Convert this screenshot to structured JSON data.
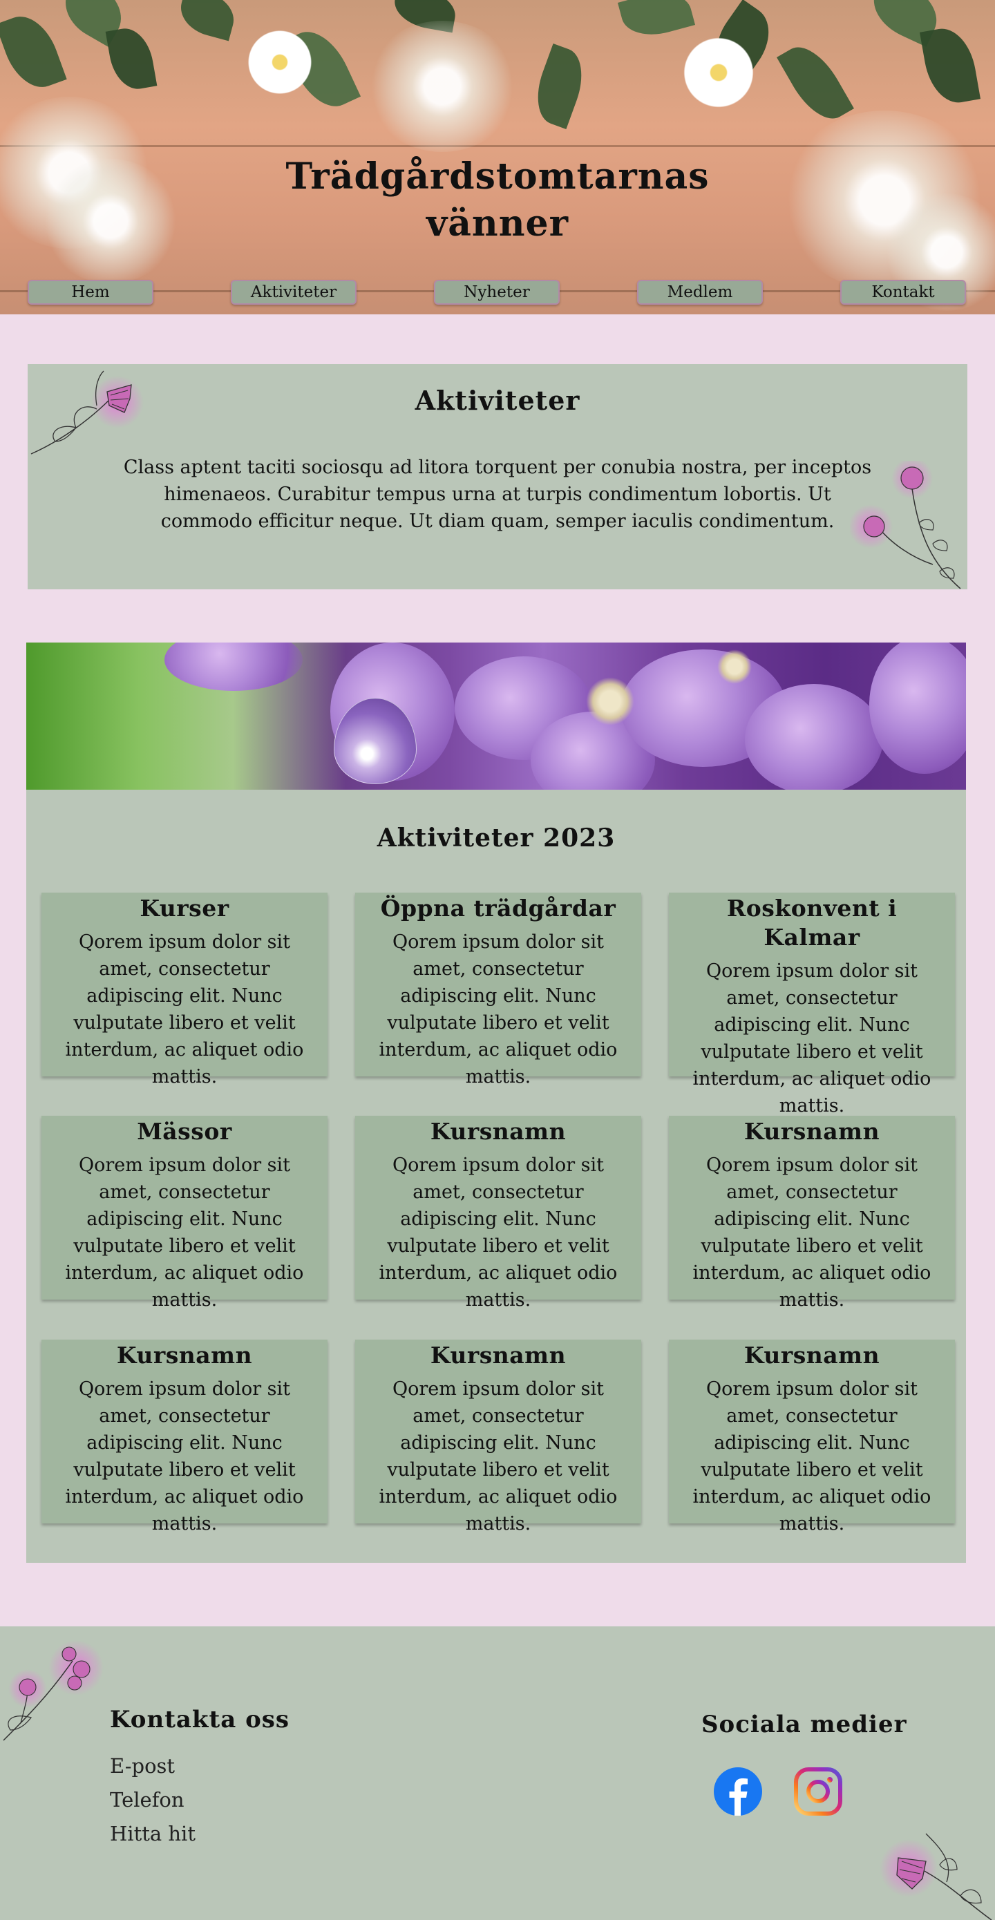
{
  "header": {
    "title_line1": "Trädgårdstomtarnas",
    "title_line2": "vänner"
  },
  "nav": {
    "items": [
      {
        "label": "Hem"
      },
      {
        "label": "Aktiviteter"
      },
      {
        "label": "Nyheter"
      },
      {
        "label": "Medlem"
      },
      {
        "label": "Kontakt"
      }
    ]
  },
  "intro": {
    "title": "Aktiviteter",
    "text": "Class aptent taciti sociosqu ad litora torquent per conubia nostra, per inceptos himenaeos. Curabitur tempus urna at turpis condimentum lobortis. Ut commodo efficitur neque. Ut diam quam, semper iaculis condimentum."
  },
  "activities": {
    "title": "Aktiviteter 2023",
    "cards": [
      {
        "title": "Kurser",
        "text": "Qorem ipsum dolor sit amet, consectetur adipiscing elit. Nunc vulputate libero et velit interdum, ac aliquet odio mattis."
      },
      {
        "title": "Öppna trädgårdar",
        "text": "Qorem ipsum dolor sit amet, consectetur adipiscing elit. Nunc vulputate libero et velit interdum, ac aliquet odio mattis."
      },
      {
        "title": "Roskonvent i Kalmar",
        "text": "Qorem ipsum dolor sit amet, consectetur adipiscing elit. Nunc vulputate libero et velit interdum, ac aliquet odio mattis."
      },
      {
        "title": "Mässor",
        "text": "Qorem ipsum dolor sit amet, consectetur adipiscing elit. Nunc vulputate libero et velit interdum, ac aliquet odio mattis."
      },
      {
        "title": "Kursnamn",
        "text": "Qorem ipsum dolor sit amet, consectetur adipiscing elit. Nunc vulputate libero et velit interdum, ac aliquet odio mattis."
      },
      {
        "title": "Kursnamn",
        "text": "Qorem ipsum dolor sit amet, consectetur adipiscing elit. Nunc vulputate libero et velit interdum, ac aliquet odio mattis."
      },
      {
        "title": "Kursnamn",
        "text": "Qorem ipsum dolor sit amet, consectetur adipiscing elit. Nunc vulputate libero et velit interdum, ac aliquet odio mattis."
      },
      {
        "title": "Kursnamn",
        "text": "Qorem ipsum dolor sit amet, consectetur adipiscing elit. Nunc vulputate libero et velit interdum, ac aliquet odio mattis."
      },
      {
        "title": "Kursnamn",
        "text": "Qorem ipsum dolor sit amet, consectetur adipiscing elit. Nunc vulputate libero et velit interdum, ac aliquet odio mattis."
      }
    ]
  },
  "footer": {
    "contact_title": "Kontakta oss",
    "contact_links": [
      {
        "label": "E-post"
      },
      {
        "label": "Telefon"
      },
      {
        "label": "Hitta hit"
      }
    ],
    "social_title": "Sociala medier",
    "social_icons": [
      "facebook-icon",
      "instagram-icon"
    ]
  },
  "colors": {
    "page_background": "#efdcea",
    "panel_background": "#bac6b8",
    "card_background": "#a1b69f",
    "nav_button": "#98a996",
    "nav_border": "#b18aa6"
  }
}
